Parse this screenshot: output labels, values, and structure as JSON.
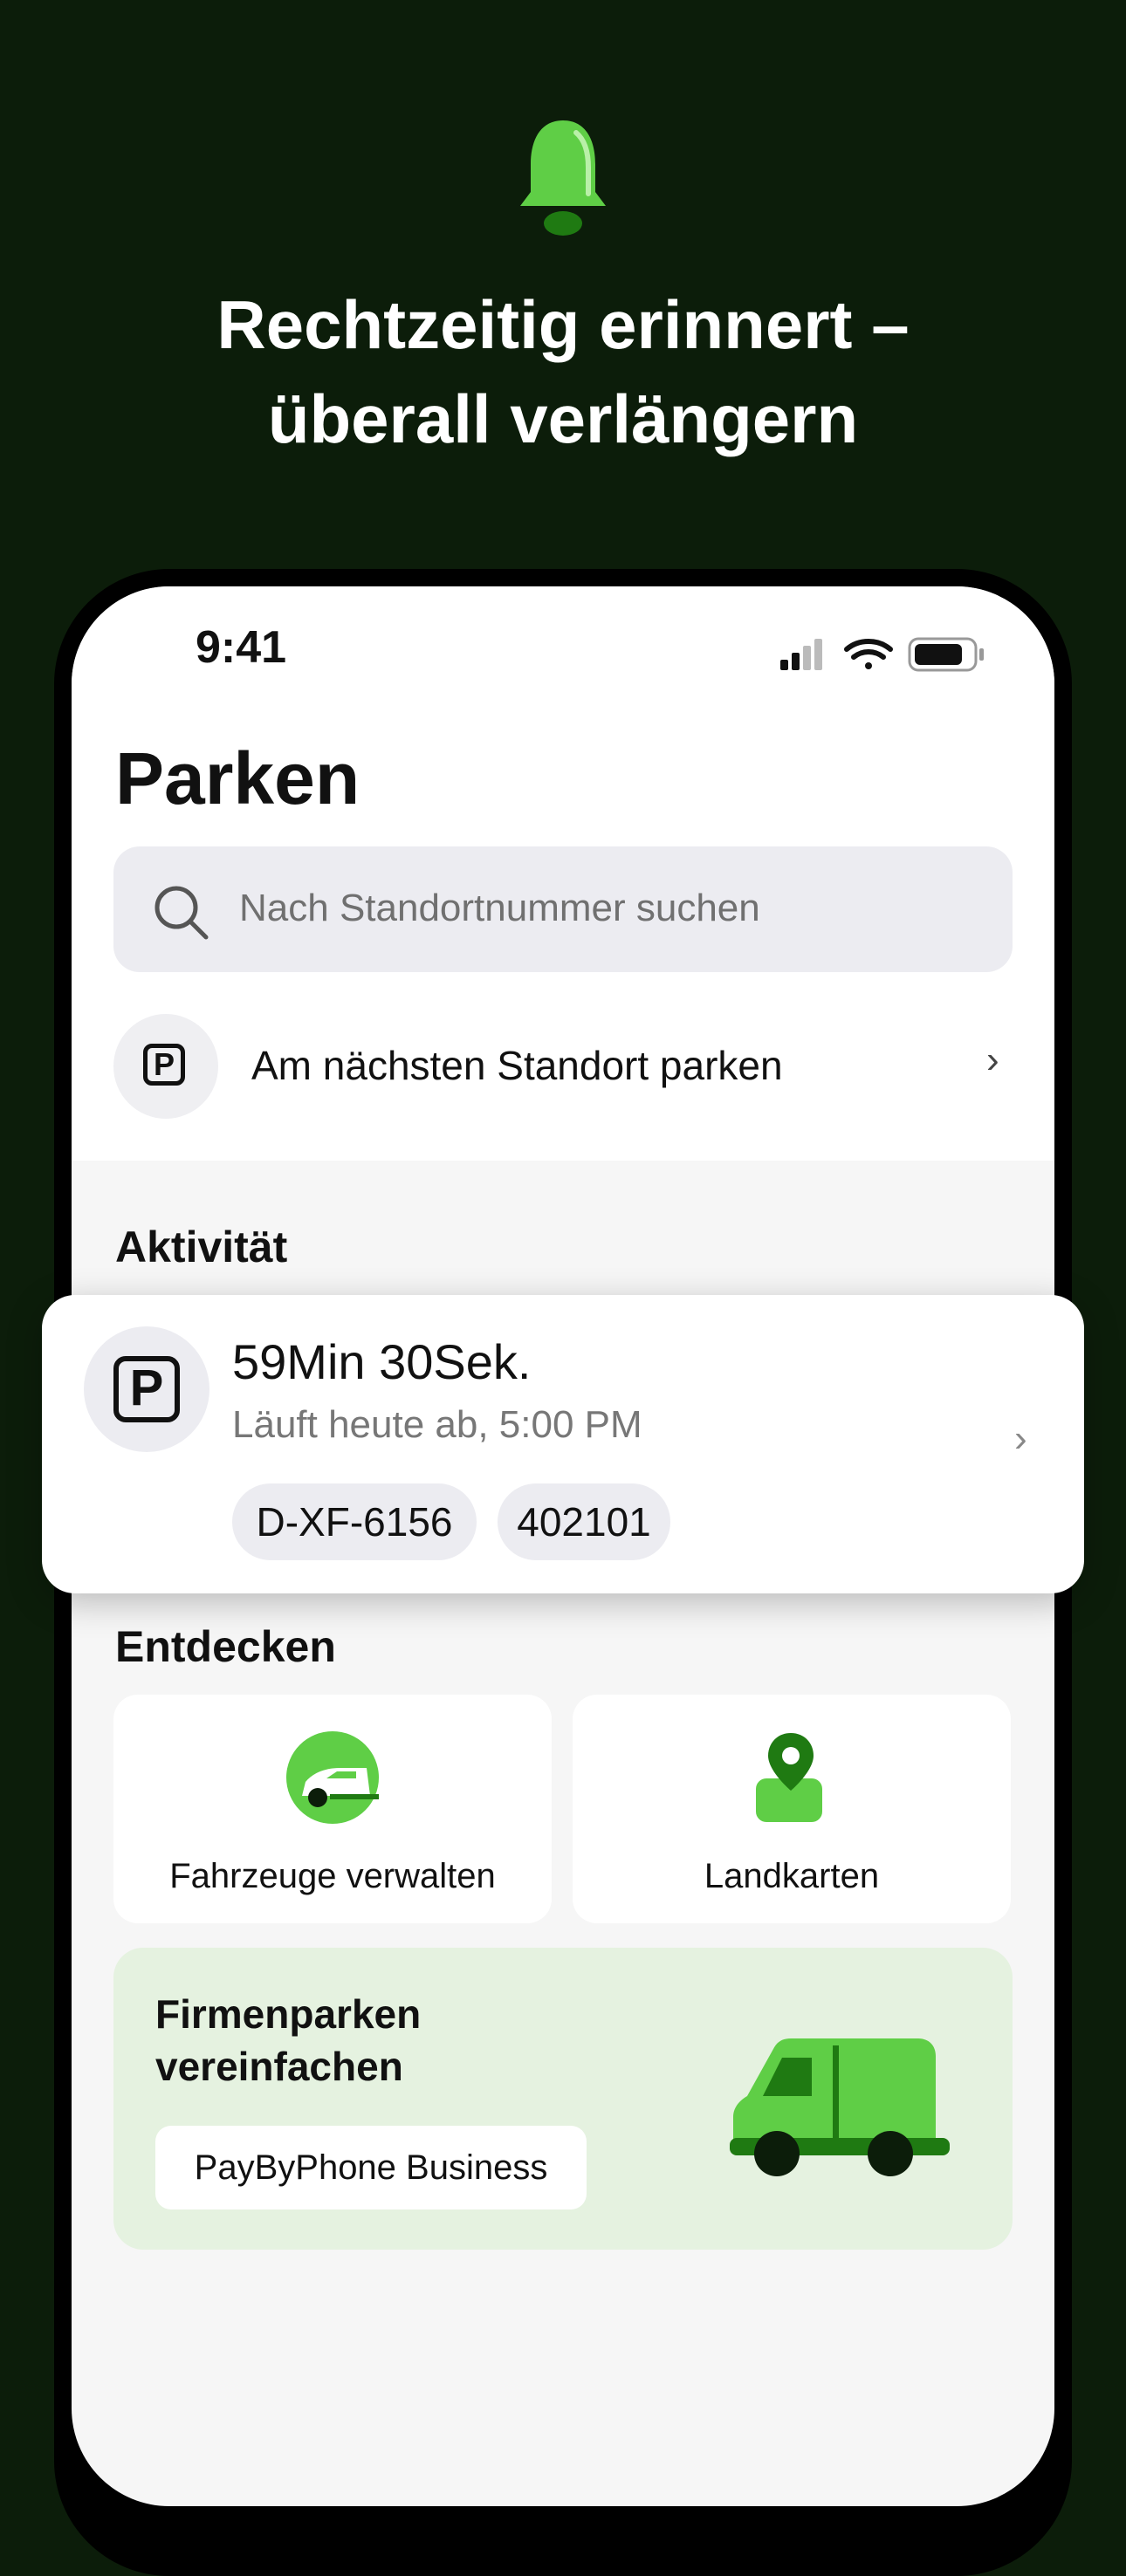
{
  "hero": {
    "title_line1": "Rechtzeitig erinnert –",
    "title_line2": "überall verlängern",
    "icon": "bell-icon"
  },
  "status_bar": {
    "time": "9:41",
    "icons": [
      "cellular-signal-icon",
      "wifi-icon",
      "battery-icon"
    ]
  },
  "page": {
    "title": "Parken"
  },
  "search": {
    "placeholder": "Nach Standortnummer suchen",
    "icon": "search-icon"
  },
  "nearest": {
    "label": "Am nächsten Standort parken",
    "icon": "parking-icon"
  },
  "activity": {
    "title": "Aktivität",
    "card": {
      "remaining": "59Min 30Sek.",
      "expires": "Läuft heute ab, 5:00 PM",
      "plate": "D-XF-6156",
      "location": "402101"
    }
  },
  "discover": {
    "title": "Entdecken",
    "tiles": [
      {
        "label": "Fahrzeuge verwalten",
        "icon": "car-icon"
      },
      {
        "label": "Landkarten",
        "icon": "map-pin-icon"
      }
    ],
    "promo": {
      "title_line1": "Firmenparken",
      "title_line2": "vereinfachen",
      "button": "PayByPhone Business",
      "icon": "van-icon"
    }
  },
  "colors": {
    "background": "#0c1d0a",
    "accent_green": "#5fce46",
    "dark_green": "#1f7a12",
    "promo_bg": "#e5f2e0"
  }
}
